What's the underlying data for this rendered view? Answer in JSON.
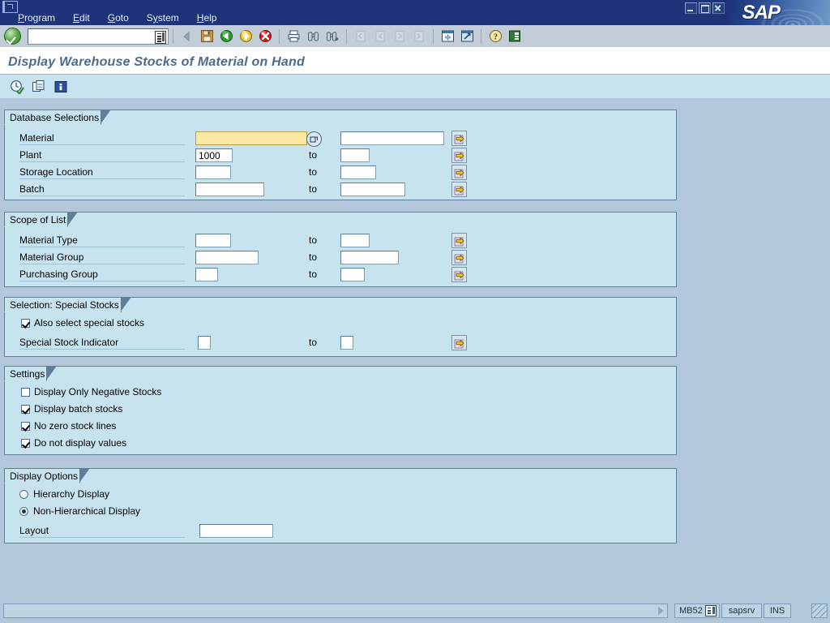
{
  "window": {
    "app_name": "SAP",
    "controls": {
      "minimize": "minimize",
      "restore": "restore",
      "close": "close"
    }
  },
  "menubar": {
    "items": [
      {
        "label": "Program",
        "accel": "P"
      },
      {
        "label": "Edit",
        "accel": "E"
      },
      {
        "label": "Goto",
        "accel": "G"
      },
      {
        "label": "System",
        "accel": "y"
      },
      {
        "label": "Help",
        "accel": "H"
      }
    ]
  },
  "system_toolbar": {
    "enter_button": "enter-check",
    "command_field": {
      "value": "",
      "placeholder": ""
    },
    "buttons": [
      {
        "name": "back-arrow-grey",
        "icon": "triangle-left",
        "enabled": false
      },
      {
        "name": "save",
        "icon": "floppy-disk",
        "enabled": true
      },
      {
        "name": "back",
        "icon": "green-left-arrow",
        "enabled": true
      },
      {
        "name": "exit",
        "icon": "yellow-up-arrow",
        "enabled": true
      },
      {
        "name": "cancel",
        "icon": "red-x",
        "enabled": true
      },
      {
        "name": "print",
        "icon": "printer",
        "enabled": true
      },
      {
        "name": "find",
        "icon": "binoculars",
        "enabled": true
      },
      {
        "name": "find-next",
        "icon": "binoculars-plus",
        "enabled": true
      },
      {
        "name": "first-page",
        "icon": "page-first",
        "enabled": false
      },
      {
        "name": "previous-page",
        "icon": "page-previous",
        "enabled": false
      },
      {
        "name": "next-page",
        "icon": "page-next",
        "enabled": false
      },
      {
        "name": "last-page",
        "icon": "page-last",
        "enabled": false
      },
      {
        "name": "create-session",
        "icon": "new-session",
        "enabled": true
      },
      {
        "name": "create-shortcut",
        "icon": "shortcut-arrow",
        "enabled": true
      },
      {
        "name": "help",
        "icon": "question-mark",
        "enabled": true
      },
      {
        "name": "customize-local-layout",
        "icon": "layout-palette",
        "enabled": true
      }
    ]
  },
  "page": {
    "title": "Display Warehouse Stocks of Material on Hand"
  },
  "app_toolbar": {
    "buttons": [
      {
        "name": "execute",
        "icon": "clock-check"
      },
      {
        "name": "multiple-selection",
        "icon": "pages"
      },
      {
        "name": "information",
        "icon": "blue-info"
      }
    ]
  },
  "groups": {
    "database_selections": {
      "title": "Database Selections",
      "rows": [
        {
          "label": "Material",
          "from": "",
          "to_label": "",
          "high": "",
          "has_search_help": true,
          "has_multi": true
        },
        {
          "label": "Plant",
          "from": "1000",
          "to_label": "to",
          "high": "",
          "has_search_help": false,
          "has_multi": true
        },
        {
          "label": "Storage Location",
          "from": "",
          "to_label": "to",
          "high": "",
          "has_search_help": false,
          "has_multi": true
        },
        {
          "label": "Batch",
          "from": "",
          "to_label": "to",
          "high": "",
          "has_search_help": false,
          "has_multi": true
        }
      ]
    },
    "scope_of_list": {
      "title": "Scope of List",
      "rows": [
        {
          "label": "Material Type",
          "from": "",
          "to_label": "to",
          "high": "",
          "has_multi": true
        },
        {
          "label": "Material Group",
          "from": "",
          "to_label": "to",
          "high": "",
          "has_multi": true
        },
        {
          "label": "Purchasing Group",
          "from": "",
          "to_label": "to",
          "high": "",
          "has_multi": true
        }
      ]
    },
    "selection_special_stocks": {
      "title": "Selection: Special Stocks",
      "checkbox": {
        "label": "Also select special stocks",
        "checked": true
      },
      "row": {
        "label": "Special Stock Indicator",
        "from": "",
        "to_label": "to",
        "high": "",
        "has_multi": true
      }
    },
    "settings": {
      "title": "Settings",
      "checkboxes": [
        {
          "label": "Display Only Negative Stocks",
          "checked": false
        },
        {
          "label": "Display batch stocks",
          "checked": true
        },
        {
          "label": "No zero stock lines",
          "checked": true
        },
        {
          "label": "Do not display values",
          "checked": true
        }
      ]
    },
    "display_options": {
      "title": "Display Options",
      "radios": [
        {
          "label": "Hierarchy Display",
          "selected": false
        },
        {
          "label": "Non-Hierarchical Display",
          "selected": true
        }
      ],
      "layout_row": {
        "label": "Layout",
        "value": ""
      }
    }
  },
  "statusbar": {
    "message": "",
    "transaction_code": "MB52",
    "server": "sapsrv",
    "insert_mode": "INS"
  },
  "colors": {
    "titlebar": "#1d3578",
    "page_background": "#b2c8da",
    "group_background": "#c7e3f0",
    "group_border": "#5f7f99",
    "title_text": "#4b6b8a",
    "focused_field": "#fbe9a2",
    "app_toolbar": "#c9e2ef"
  }
}
